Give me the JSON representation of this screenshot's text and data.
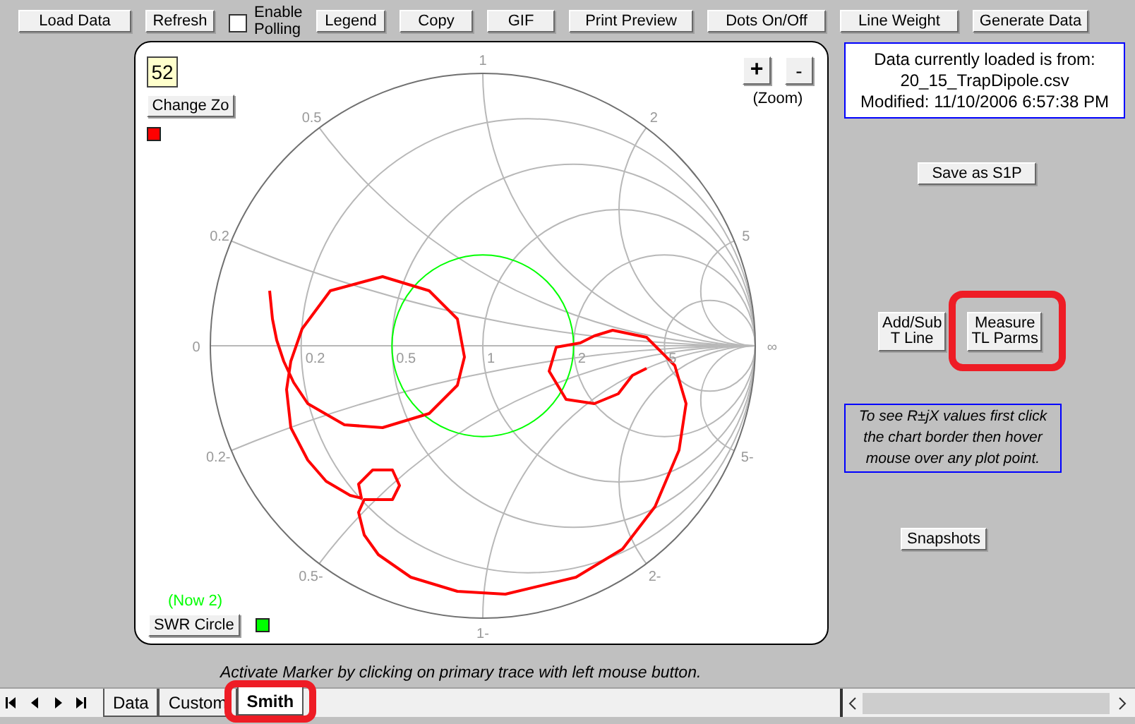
{
  "toolbar": [
    {
      "kind": "button",
      "label": "Load Data"
    },
    {
      "kind": "button",
      "label": "Refresh"
    },
    {
      "kind": "checkbox",
      "label": "Enable Polling",
      "checked": false
    },
    {
      "kind": "button",
      "label": "Legend"
    },
    {
      "kind": "button",
      "label": "Copy"
    },
    {
      "kind": "button",
      "label": "GIF"
    },
    {
      "kind": "button",
      "label": "Print Preview"
    },
    {
      "kind": "button",
      "label": "Dots On/Off"
    },
    {
      "kind": "button",
      "label": "Line Weight"
    },
    {
      "kind": "button",
      "label": "Generate Data"
    }
  ],
  "chart": {
    "zo_value": "52",
    "change_zo_button": "Change Zo",
    "zoom_in": "+",
    "zoom_out": "-",
    "zoom_label": "(Zoom)",
    "swr_note": "(Now 2)",
    "swr_button": "SWR Circle",
    "reactance_labels_upper": [
      "0.2",
      "0.5",
      "1",
      "2",
      "5"
    ],
    "resistance_labels": [
      "0",
      "0.2",
      "0.5",
      "1",
      "2",
      "5",
      "∞"
    ],
    "reactance_labels_lower": [
      "0.2-",
      "0.5-",
      "1-",
      "2-",
      "5-"
    ]
  },
  "info": {
    "lines": [
      "Data currently loaded is from:",
      "20_15_TrapDipole.csv",
      "Modified: 11/10/2006 6:57:38 PM"
    ]
  },
  "save_button": "Save as S1P",
  "tool_buttons": [
    {
      "label_lines": [
        "Add/Sub",
        "T Line"
      ],
      "highlighted": false
    },
    {
      "label_lines": [
        "Measure",
        "TL Parms"
      ],
      "highlighted": true
    }
  ],
  "hint": "To see R±jX values first click the chart border then hover mouse over any plot point.",
  "snapshots_button": "Snapshots",
  "status_text": "Activate Marker by clicking on primary trace with left mouse button.",
  "sheet_tabs": [
    {
      "label": "Data",
      "selected": false,
      "highlighted": false
    },
    {
      "label": "Custom",
      "selected": false,
      "highlighted": false
    },
    {
      "label": "Smith",
      "selected": true,
      "highlighted": true
    }
  ]
}
